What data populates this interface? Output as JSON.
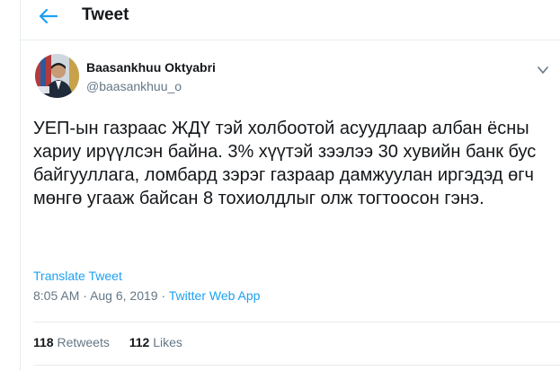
{
  "header": {
    "title": "Tweet",
    "back_icon": "arrow-left-icon",
    "accent": "#1da1f2"
  },
  "tweet": {
    "author_name": "Baasankhuu Oktyabri",
    "author_handle": "@baasankhuu_o",
    "text": "УЕП-ын газраас ЖДҮ тэй холбоотой асуудлаар албан ёсны хариу ирүүлсэн байна. 3% хүүтэй зээлээ 30 хувийн банк бус байгууллага, ломбард зэрэг газраар дамжуулан иргэдэд өгч мөнгө угааж байсан 8 тохиолдлыг олж тогтоосон гэнэ.",
    "translate_label": "Translate Tweet",
    "time": "8:05 AM",
    "date": "Aug 6, 2019",
    "separator": "·",
    "source": "Twitter Web App",
    "caret_icon": "chevron-down-icon"
  },
  "stats": {
    "retweets_count": "118",
    "retweets_label": "Retweets",
    "likes_count": "112",
    "likes_label": "Likes"
  }
}
